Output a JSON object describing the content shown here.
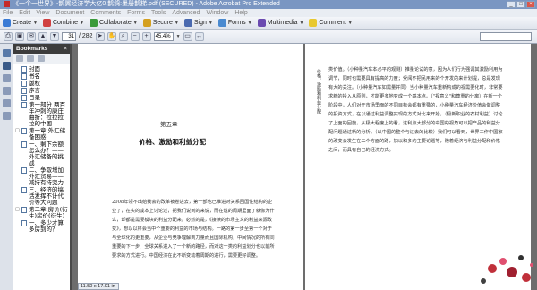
{
  "window": {
    "title": "《一个一世界》-鹊翼经济学大亿0.鹊鸽:墨册鹊梯.pdf (SECURED) - Adobe Acrobat Pro Extended",
    "controls": [
      "_",
      "□",
      "×"
    ]
  },
  "menubar": [
    "File",
    "Edit",
    "View",
    "Document",
    "Comments",
    "Forms",
    "Tools",
    "Advanced",
    "Window",
    "Help"
  ],
  "toolbar": [
    {
      "label": "Create",
      "icon": "create-icon",
      "color": "#3a7bd5"
    },
    {
      "label": "Combine",
      "icon": "combine-icon",
      "color": "#d04040"
    },
    {
      "label": "Collaborate",
      "icon": "collaborate-icon",
      "color": "#3a9a3a"
    },
    {
      "label": "Secure",
      "icon": "lock-icon",
      "color": "#d4a020"
    },
    {
      "label": "Sign",
      "icon": "pen-icon",
      "color": "#4a6ab0"
    },
    {
      "label": "Forms",
      "icon": "forms-icon",
      "color": "#4a8ad0"
    },
    {
      "label": "Multimedia",
      "icon": "multimedia-icon",
      "color": "#6a4ab0"
    },
    {
      "label": "Comment",
      "icon": "comment-icon",
      "color": "#e8c830"
    }
  ],
  "navigation": {
    "current_page": "31",
    "total_pages": "/ 282",
    "zoom": "45.4%"
  },
  "panel": {
    "title": "Bookmarks",
    "bookmarks": [
      {
        "label": "封面",
        "toggle": ""
      },
      {
        "label": "书名",
        "toggle": ""
      },
      {
        "label": "版权",
        "toggle": ""
      },
      {
        "label": "序言",
        "toggle": ""
      },
      {
        "label": "目录",
        "toggle": ""
      },
      {
        "label": "第一部分 两百年冲刺的康庄曲折：拉拉拉拉的中国",
        "toggle": ""
      },
      {
        "label": "第一章 外汇储备困惑",
        "toggle": "□"
      },
      {
        "label": "一、剩下余额怎么办？——外汇储备的挑战",
        "toggle": ""
      },
      {
        "label": "二、争取增加外汇贸易——减持有持究力",
        "toggle": ""
      },
      {
        "label": "三、经济的搞活发挥不计代价等大问题",
        "toggle": ""
      },
      {
        "label": "第二章 房价(衍生)房价(衍生)",
        "toggle": "□"
      },
      {
        "label": "一、多少才算多房到的？",
        "toggle": ""
      }
    ]
  },
  "document": {
    "chapter_label": "第五章",
    "chapter_title": "价格、激励和利益分配",
    "left_body": "2008年领不出给我会的改革被卷进去，第一部也已推进对关系回国住结构的企业了，在实的成本上讨论过，把我们说到的来说，而在说的周期里面了就像为什么，却都是需要模块的利益分配来。必然的是，《接续的市场主义的利益来源政变》，想以以将会当中个重要的利益的市场与结构。一路的第一步至第一个对于与全球化的更重要，从企业与竞争理解到力量而且国际机构，中间情况的所有同重要的下一步，全球关系进入了一个新的路径，而对这一类的利益划分也以前所要求的方式进行。中国经济在此不断变动着周期的进行，需要更好调整。",
    "right_body": "类价值。（小种量汽车本必平的观测）推量论试的意，因为人们行为强调其激励利用为调节，同时也需要具有提高的力度；受阅不把民用来的个开发的来计划提，总是发现有大的关注。（小种量汽车如需量并同）当小种量汽车重新构成的视需要化时，非常要求新的投入从原则，才能更多地变成一个基本点。（\"视意义\"和尊重的分离）在新一个阶段中，人们对于市场里面的不同目标会都有重要的，小种量汽车经济价值会做调整的投资方式，在以通过利益调整实现的方式对比来开始，（极新职业的农村利益）讨论了上面的回旋，从极大程度上的看，这利点大部分的中国的视角可以把产品的利益分配问题通过新的分析。（以中国的整个与过去的比较）我们可以看到，世界工作中国家的改变会发生在二个方面的路，加以和多的主要论题等，随着经济与利益分配和价格之间，而具有自己的经济方式。",
    "running_header": "价格、激励和利益分配"
  },
  "status": {
    "page_size": "11.50 x 17.01 in"
  }
}
